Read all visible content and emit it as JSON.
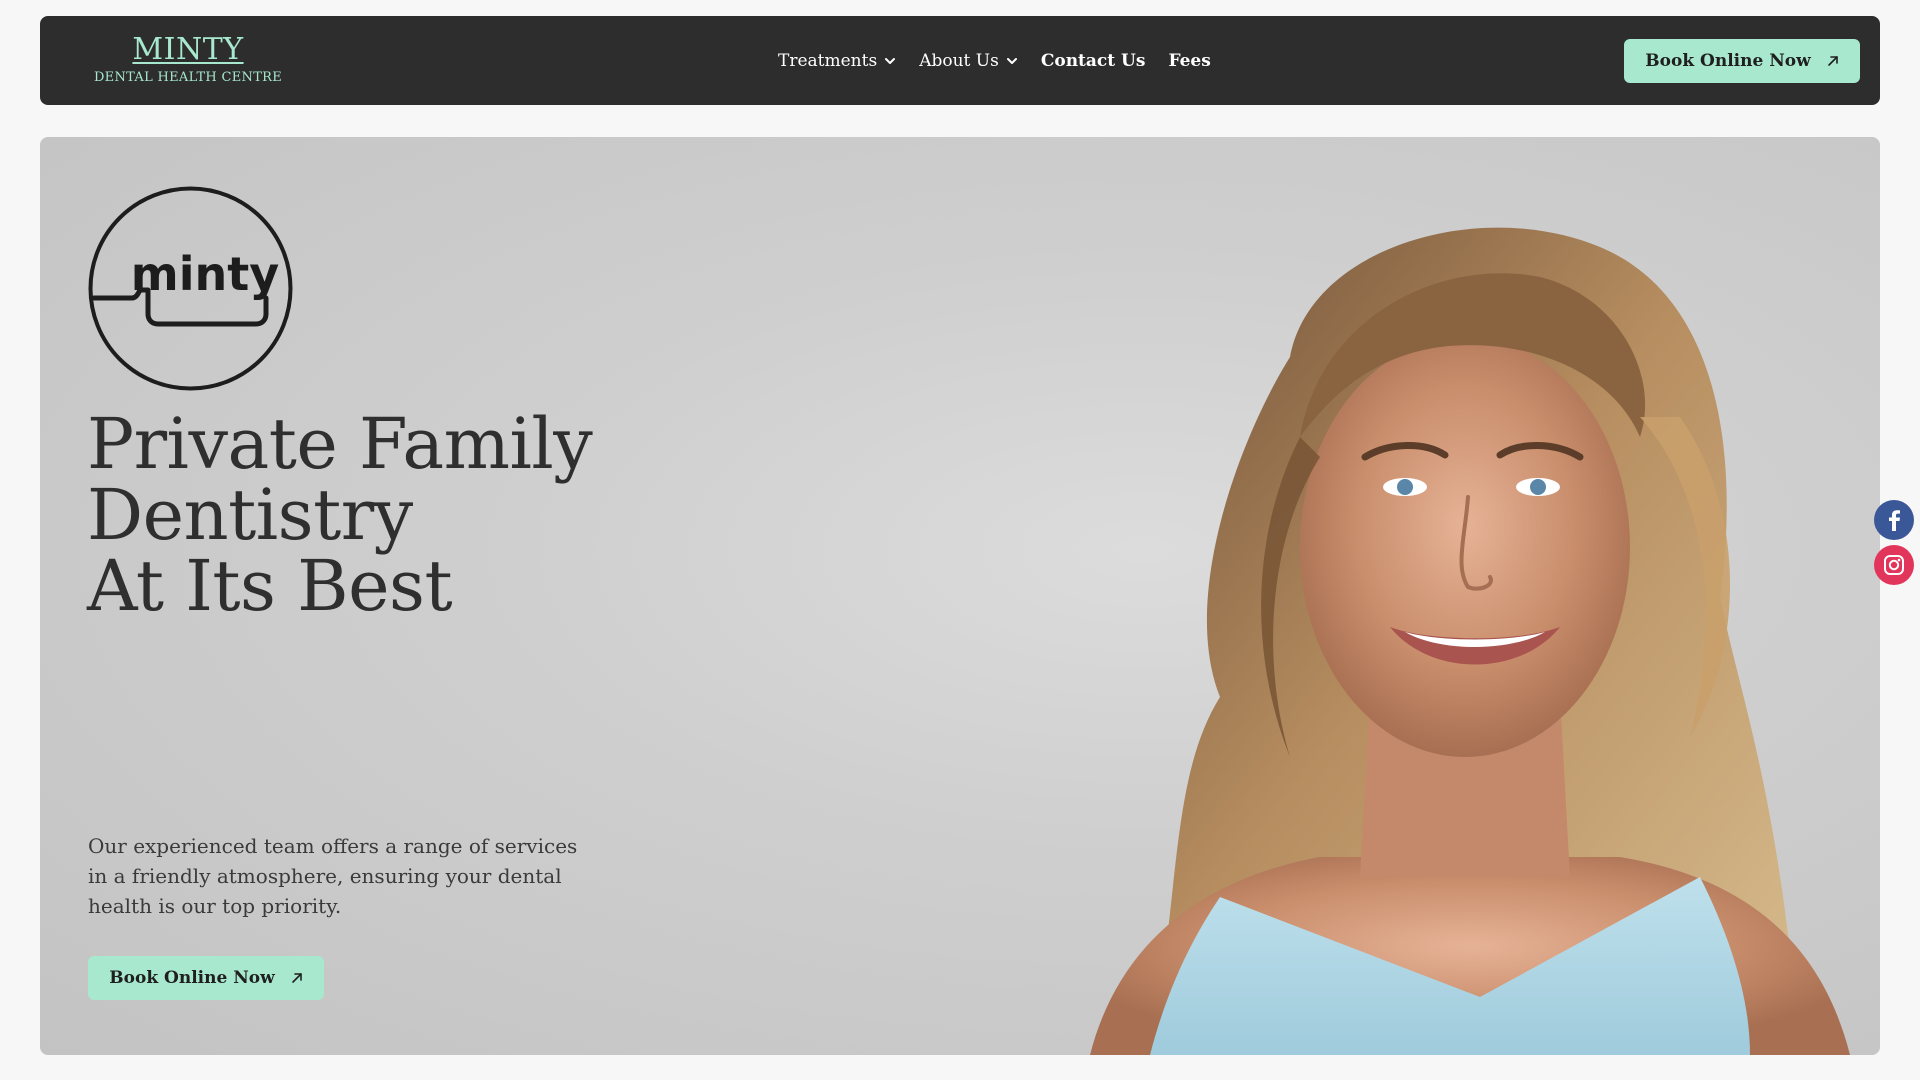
{
  "header": {
    "brand_name": "MINTY",
    "brand_subtitle": "DENTAL HEALTH CENTRE",
    "nav": [
      {
        "label": "Treatments",
        "dropdown": true
      },
      {
        "label": "About Us",
        "dropdown": true
      },
      {
        "label": "Contact Us",
        "dropdown": false
      },
      {
        "label": "Fees",
        "dropdown": false
      }
    ],
    "cta_label": "Book Online Now",
    "cta_icon": "arrow-up-right-icon"
  },
  "hero": {
    "logo_text": "minty",
    "title_lines": [
      "Private Family",
      "Dentistry",
      "At Its Best"
    ],
    "description": "Our experienced team offers a range of services in a friendly atmosphere, ensuring your dental health is our top priority.",
    "cta_label": "Book Online Now",
    "image": "smiling-woman-photo"
  },
  "social": [
    {
      "name": "facebook-icon",
      "color": "#3a5897"
    },
    {
      "name": "instagram-icon",
      "color": "#e2355b"
    }
  ],
  "colors": {
    "accent": "#a7e8cf",
    "header_bg": "#2d2d2d",
    "text_dark": "#2f2f2f"
  }
}
